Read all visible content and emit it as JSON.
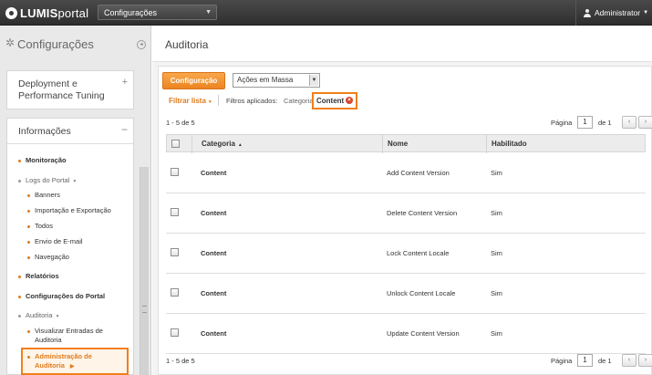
{
  "topbar": {
    "logo_left": "LUMIS",
    "logo_right": "portal",
    "site_select": "Configurações",
    "user": "Administrator"
  },
  "sidebar": {
    "title": "Configurações",
    "panels": [
      {
        "title": "Deployment e Performance Tuning",
        "icon": "plus-icon",
        "expanded": false
      },
      {
        "title": "Informações",
        "icon": "minus-icon",
        "expanded": true
      }
    ],
    "items": [
      {
        "label": "Monitoração",
        "level": 1
      },
      {
        "label": "Logs do Portal",
        "level": 1
      },
      {
        "label": "Banners",
        "level": 2
      },
      {
        "label": "Importação e Exportação",
        "level": 2
      },
      {
        "label": "Todos",
        "level": 2
      },
      {
        "label": "Envio de E-mail",
        "level": 2
      },
      {
        "label": "Navegação",
        "level": 2
      },
      {
        "label": "Relatórios",
        "level": 1
      },
      {
        "label": "Configurações do Portal",
        "level": 1
      },
      {
        "label": "Auditoria",
        "level": 1
      },
      {
        "label_line1": "Visualizar Entradas de",
        "label_line2": "Auditoria",
        "level": 2
      },
      {
        "label_line1": "Administração de",
        "label_line2": "Auditoria",
        "level": 2,
        "active": true
      }
    ]
  },
  "main": {
    "title": "Auditoria",
    "toolbar": {
      "config_button": "Configuração",
      "bulk_actions": "Ações em Massa"
    },
    "filters": {
      "filter_link": "Filtrar lista",
      "applied_label": "Filtros aplicados:",
      "category_label": "Categoria",
      "tag": "Content"
    },
    "range_text": "1 - 5 de 5",
    "pager": {
      "page_label": "Página",
      "page_value": "1",
      "of_label": "de 1",
      "prev": "‹",
      "next": "›"
    },
    "table": {
      "columns": [
        "Categoria",
        "Nome",
        "Habilitado"
      ],
      "rows": [
        {
          "categoria": "Content",
          "nome": "Add Content Version",
          "habilitado": "Sim"
        },
        {
          "categoria": "Content",
          "nome": "Delete Content Version",
          "habilitado": "Sim"
        },
        {
          "categoria": "Content",
          "nome": "Lock Content Locale",
          "habilitado": "Sim"
        },
        {
          "categoria": "Content",
          "nome": "Unlock Content Locale",
          "habilitado": "Sim"
        },
        {
          "categoria": "Content",
          "nome": "Update Content Version",
          "habilitado": "Sim"
        }
      ]
    }
  },
  "colors": {
    "accent": "#f08a24",
    "highlight": "#f07f1a",
    "topbar": "#3a3a3a"
  }
}
